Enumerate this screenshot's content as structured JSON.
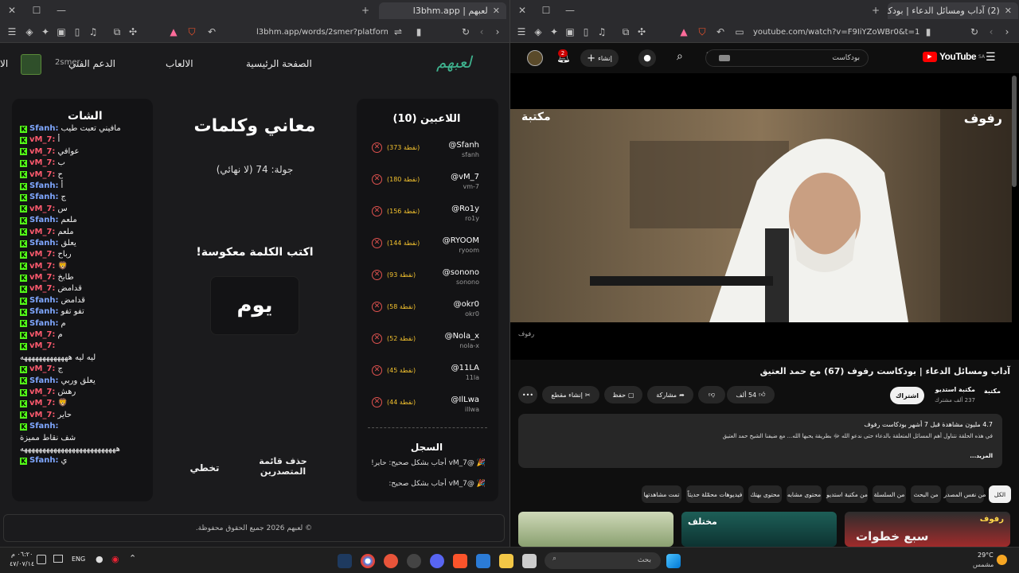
{
  "left_browser": {
    "tab_title": "لعبهم | l3bhm.app",
    "url": "l3bhm.app/words/2smer?platform=kick"
  },
  "right_browser": {
    "tab_title": "(2) آداب ومسائل الدعاء | بودكا",
    "url": "youtube.com/watch?v=F9IiYZoWBr0&t=1..."
  },
  "site": {
    "logo": "لعبهم",
    "nav": {
      "home": "الصفحة الرئيسية",
      "games": "الالعاب",
      "support": "الدعم الفني",
      "user": "2smer",
      "more": "الا"
    }
  },
  "chat": {
    "title": "الشات",
    "messages": [
      {
        "user": "Sfanh:",
        "text": "مافيني تعبت طيب",
        "color": "#7fa7ff"
      },
      {
        "user": "vM_7:",
        "text": "أ",
        "color": "#ff5a6e"
      },
      {
        "user": "vM_7:",
        "text": "عوافي",
        "color": "#ff5a6e"
      },
      {
        "user": "vM_7:",
        "text": "ب",
        "color": "#ff5a6e"
      },
      {
        "user": "vM_7:",
        "text": "ح",
        "color": "#ff5a6e"
      },
      {
        "user": "Sfanh:",
        "text": "أ",
        "color": "#7fa7ff"
      },
      {
        "user": "Sfanh:",
        "text": "ج",
        "color": "#7fa7ff"
      },
      {
        "user": "vM_7:",
        "text": "س",
        "color": "#ff5a6e"
      },
      {
        "user": "Sfanh:",
        "text": "ملعم",
        "color": "#7fa7ff"
      },
      {
        "user": "vM_7:",
        "text": "ملعم",
        "color": "#ff5a6e"
      },
      {
        "user": "Sfanh:",
        "text": "يعلق",
        "color": "#7fa7ff"
      },
      {
        "user": "vM_7:",
        "text": "رباح",
        "color": "#ff5a6e"
      },
      {
        "user": "vM_7:",
        "text": "🦁",
        "color": "#ff5a6e"
      },
      {
        "user": "vM_7:",
        "text": "طابخ",
        "color": "#ff5a6e"
      },
      {
        "user": "vM_7:",
        "text": "قدامض",
        "color": "#ff5a6e"
      },
      {
        "user": "Sfanh:",
        "text": "قدامض",
        "color": "#7fa7ff"
      },
      {
        "user": "Sfanh:",
        "text": "تفو تفو",
        "color": "#7fa7ff"
      },
      {
        "user": "Sfanh:",
        "text": "م",
        "color": "#7fa7ff"
      },
      {
        "user": "vM_7:",
        "text": "م",
        "color": "#ff5a6e"
      },
      {
        "user": "vM_7:",
        "text": "",
        "color": "#ff5a6e"
      },
      {
        "user": "",
        "text": "ليه ليه هههههههههههههه",
        "color": "#ff5a6e"
      },
      {
        "user": "vM_7:",
        "text": "ج",
        "color": "#ff5a6e"
      },
      {
        "user": "Sfanh:",
        "text": "يعلق وربي",
        "color": "#7fa7ff"
      },
      {
        "user": "vM_7:",
        "text": "رهش",
        "color": "#ff5a6e"
      },
      {
        "user": "vM_7:",
        "text": "🦁",
        "color": "#ff5a6e"
      },
      {
        "user": "vM_7:",
        "text": "حاير",
        "color": "#ff5a6e"
      },
      {
        "user": "Sfanh:",
        "text": "",
        "color": "#7fa7ff"
      },
      {
        "user": "",
        "text": "شف نقاط مميزة",
        "color": "#7fa7ff"
      },
      {
        "user": "",
        "text": "ههههههههههههههههههههههههههه",
        "color": "#7fa7ff"
      },
      {
        "user": "Sfanh:",
        "text": "ي",
        "color": "#7fa7ff"
      }
    ]
  },
  "game": {
    "title": "معاني وكلمات",
    "round": "جولة: 74 (لا نهائي)",
    "instruction": "اكتب الكلمة معكوسة!",
    "word": "يوم",
    "delete_leaderboard": "حذف قائمة المتصدرين",
    "skip": "تخطي"
  },
  "players": {
    "title": "اللاعبين (10)",
    "list": [
      {
        "handle": "@Sfanh",
        "sub": "sfanh",
        "points": "(373 نقطة)"
      },
      {
        "handle": "@vM_7",
        "sub": "vm-7",
        "points": "(180 نقطة)"
      },
      {
        "handle": "@Ro1y",
        "sub": "ro1y",
        "points": "(156 نقطة)"
      },
      {
        "handle": "@RYOOM",
        "sub": "ryoom",
        "points": "(144 نقطة)"
      },
      {
        "handle": "@sonono",
        "sub": "sonono",
        "points": "(93 نقطة)"
      },
      {
        "handle": "@okr0",
        "sub": "okr0",
        "points": "(58 نقطة)"
      },
      {
        "handle": "@Nola_x",
        "sub": "nola-x",
        "points": "(52 نقطة)"
      },
      {
        "handle": "@11LA",
        "sub": "11la",
        "points": "(45 نقطة)"
      },
      {
        "handle": "@IlLwa",
        "sub": "illwa",
        "points": "(44 نقطة)"
      }
    ]
  },
  "log": {
    "title": "السجل",
    "entries": [
      "🎉 @vM_7 أجاب بشكل صحيح: حاير!",
      "🎉 @vM_7 أجاب بشكل صحيح:"
    ]
  },
  "footer": "© لعبهم 2026 جميع الحقوق محفوظة.",
  "youtube": {
    "logo": "YouTube",
    "logo_region": "SA",
    "search_value": "بودكاست",
    "create_label": "إنشاء",
    "notif_count": "2",
    "video_brand": "رفوف",
    "video_brand_2": "مكتبة",
    "video_watermark": "رفوف",
    "title": "آداب ومسائل الدعاء | بودكاست رفوف (67) مع حمد العتيق",
    "channel": "مكتبة استديو",
    "subscribers": "237 ألف مشترك",
    "subscribe": "اشتراك",
    "likes": "54 ألف",
    "share": "مشاركة",
    "save": "حفظ",
    "clip": "إنشاء مقطع",
    "desc_stats": "4.7 مليون مشاهدة قبل 7 أشهر  بودكاست رفوف",
    "desc_text": "في هذه الحلقة نتناول أهم المسائل المتعلقة بالدعاء حتى ندعو الله ﷻ بطريقة يحبها الله... مع ضيفنا الشيخ حمد العتيق",
    "desc_more": "...المزيد",
    "chips": [
      "الكل",
      "من نفس المصدر",
      "من البحث",
      "من السلسلة",
      "من مكتبة استديو",
      "محتوى مشابه",
      "محتوى بهتك",
      "فيديوهات محمّلة حديثاً",
      "تمت مشاهدتها"
    ],
    "thumb_texts": [
      "رفوف",
      "سبع خطوات",
      "مختلف"
    ]
  },
  "taskbar": {
    "date": "٤٧/٠٧/١٤",
    "time": "٠٦:٢٠ م",
    "lang": "ENG",
    "search": "بحث",
    "temp": "29°C",
    "weather": "مشمس"
  },
  "colors": {
    "accent_green": "#3fb38f",
    "kick_green": "#53fc18",
    "yt_red": "#ff0000",
    "points_yellow": "#f2c12e"
  }
}
